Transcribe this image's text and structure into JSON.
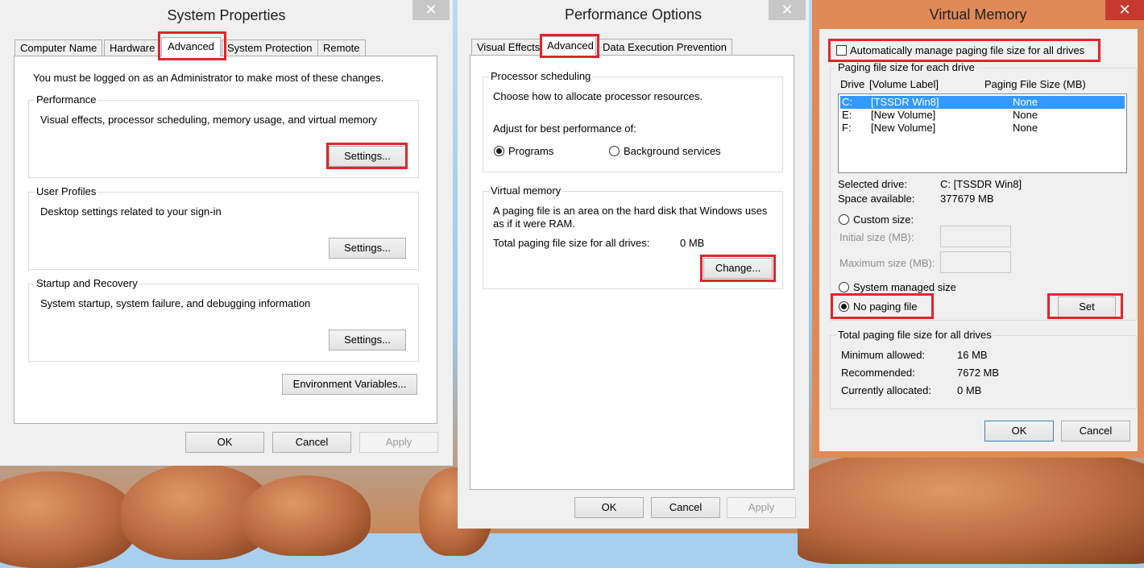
{
  "system_properties": {
    "title": "System Properties",
    "tabs": [
      "Computer Name",
      "Hardware",
      "Advanced",
      "System Protection",
      "Remote"
    ],
    "admin_note": "You must be logged on as an Administrator to make most of these changes.",
    "performance": {
      "title": "Performance",
      "desc": "Visual effects, processor scheduling, memory usage, and virtual memory",
      "button": "Settings..."
    },
    "user_profiles": {
      "title": "User Profiles",
      "desc": "Desktop settings related to your sign-in",
      "button": "Settings..."
    },
    "startup_recovery": {
      "title": "Startup and Recovery",
      "desc": "System startup, system failure, and debugging information",
      "button": "Settings..."
    },
    "env_button": "Environment Variables...",
    "ok": "OK",
    "cancel": "Cancel",
    "apply": "Apply"
  },
  "performance_options": {
    "title": "Performance Options",
    "tabs": [
      "Visual Effects",
      "Advanced",
      "Data Execution Prevention"
    ],
    "processor": {
      "title": "Processor scheduling",
      "desc": "Choose how to allocate processor resources.",
      "adjust": "Adjust for best performance of:",
      "programs": "Programs",
      "background": "Background services"
    },
    "virtual_memory": {
      "title": "Virtual memory",
      "desc1": "A paging file is an area on the hard disk that Windows uses",
      "desc2": "as if it were RAM.",
      "total_label": "Total paging file size for all drives:",
      "total_value": "0 MB",
      "button": "Change..."
    },
    "ok": "OK",
    "cancel": "Cancel",
    "apply": "Apply"
  },
  "virtual_memory": {
    "title": "Virtual Memory",
    "auto_manage": "Automatically manage paging file size for all drives",
    "group_title": "Paging file size for each drive",
    "col_drive": "Drive",
    "col_label": "[Volume Label]",
    "col_size": "Paging File Size (MB)",
    "drives": [
      {
        "drive": "C:",
        "label": "[TSSDR Win8]",
        "size": "None"
      },
      {
        "drive": "E:",
        "label": "[New Volume]",
        "size": "None"
      },
      {
        "drive": "F:",
        "label": "[New Volume]",
        "size": "None"
      }
    ],
    "selected_label": "Selected drive:",
    "selected_value": "C:  [TSSDR Win8]",
    "space_label": "Space available:",
    "space_value": "377679 MB",
    "custom_size": "Custom size:",
    "initial_size": "Initial size (MB):",
    "maximum_size": "Maximum size (MB):",
    "system_managed": "System managed size",
    "no_paging": "No paging file",
    "set_button": "Set",
    "totals_title": "Total paging file size for all drives",
    "min_label": "Minimum allowed:",
    "min_value": "16 MB",
    "rec_label": "Recommended:",
    "rec_value": "7672 MB",
    "cur_label": "Currently allocated:",
    "cur_value": "0 MB",
    "ok": "OK",
    "cancel": "Cancel"
  },
  "close_glyph": "✕",
  "colors": {
    "highlight": "#e3242b",
    "vm_frame": "#e08a57",
    "sp_frame": "#f0f0f0",
    "selection": "#3399ff",
    "close_button": "#c7c7c7"
  }
}
